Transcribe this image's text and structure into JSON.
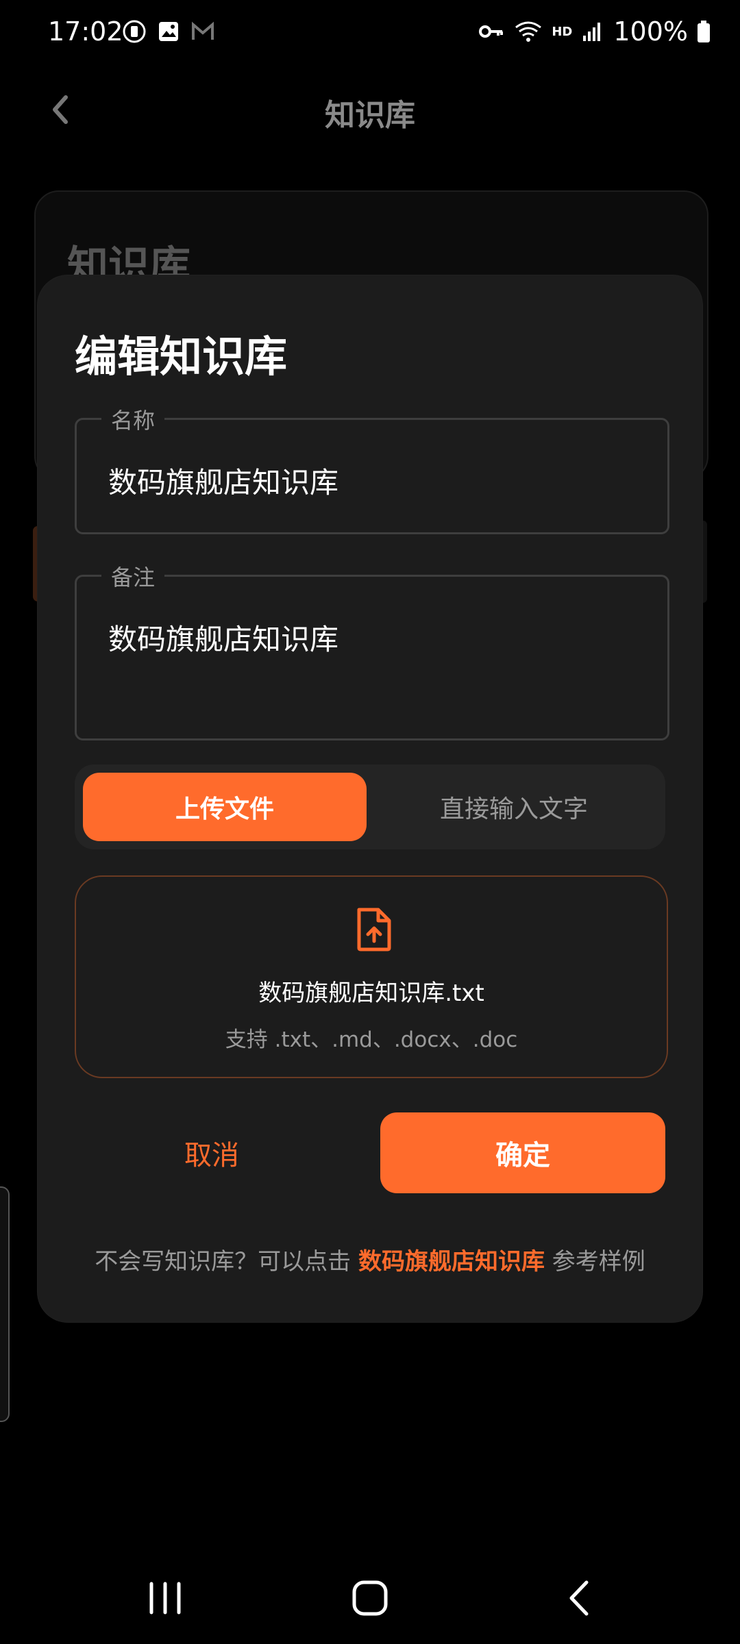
{
  "status_bar": {
    "time": "17:02",
    "battery_percent": "100%",
    "network_label": "HD"
  },
  "header": {
    "title": "知识库"
  },
  "background_card": {
    "title": "知识库"
  },
  "dialog": {
    "title": "编辑知识库",
    "name_field": {
      "label": "名称",
      "value": "数码旗舰店知识库"
    },
    "note_field": {
      "label": "备注",
      "value": "数码旗舰店知识库"
    },
    "mode_tabs": [
      {
        "label": "上传文件",
        "active": true
      },
      {
        "label": "直接输入文字",
        "active": false
      }
    ],
    "upload": {
      "file_name": "数码旗舰店知识库.txt",
      "supported_hint": "支持 .txt、.md、.docx、.doc"
    },
    "cancel_label": "取消",
    "confirm_label": "确定",
    "tip": {
      "prefix": "不会写知识库？可以点击 ",
      "link": "数码旗舰店知识库",
      "suffix": " 参考样例"
    }
  },
  "colors": {
    "accent": "#ff6b2c",
    "dialog_bg": "#1c1c1c",
    "page_bg": "#000000"
  }
}
